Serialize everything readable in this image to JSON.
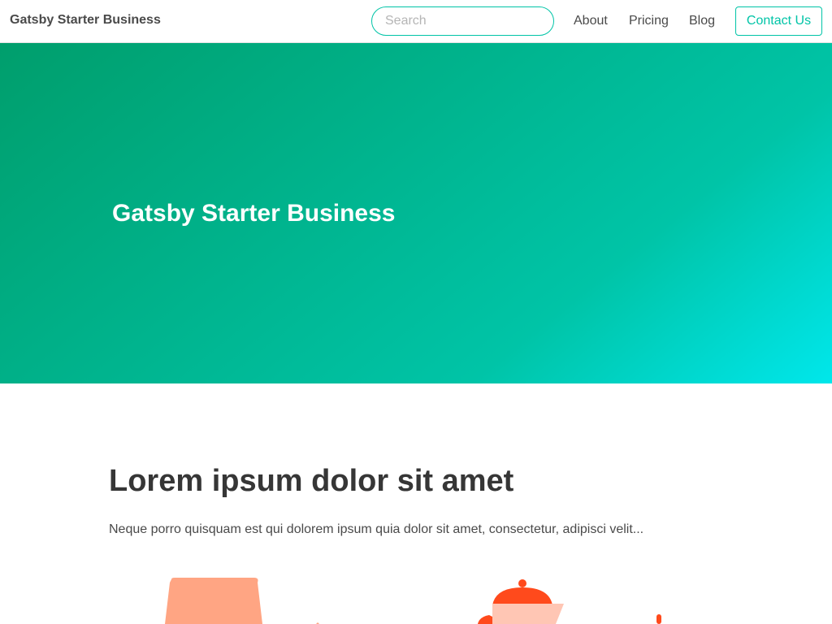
{
  "navbar": {
    "brand": "Gatsby Starter Business",
    "search": {
      "placeholder": "Search",
      "value": ""
    },
    "links": [
      {
        "label": "About"
      },
      {
        "label": "Pricing"
      },
      {
        "label": "Blog"
      }
    ],
    "contact_label": "Contact Us"
  },
  "hero": {
    "title": "Gatsby Starter Business",
    "gradient_colors": [
      "#009e6c",
      "#00c4a7",
      "#00e7eb"
    ]
  },
  "section": {
    "title": "Lorem ipsum dolor sit amet",
    "text": "Neque porro quisquam est qui dolorem ipsum quia dolor sit amet, consectetur, adipisci velit..."
  },
  "illustrations": [
    {
      "name": "coffee-bag-icon",
      "color": "#ffa583"
    },
    {
      "name": "teapot-icon",
      "color": "#ff4a1c"
    }
  ],
  "colors": {
    "accent": "#00c4a7",
    "text": "#363636",
    "illustration_light": "#ffa583",
    "illustration_dark": "#ff4a1c"
  }
}
